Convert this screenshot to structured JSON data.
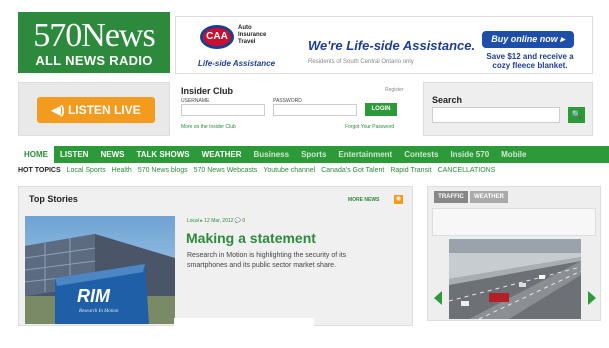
{
  "logo": {
    "line1": "570News",
    "line2": "ALL NEWS RADIO"
  },
  "ad": {
    "brand": "CAA",
    "brand_lines": [
      "Auto",
      "Insurance",
      "Travel"
    ],
    "tagline": "Life-side Assistance",
    "slogan": "We're Life-side Assistance.",
    "subtext": "Residents of South Central Ontario only",
    "button": "Buy online now ▸",
    "offer": "Save $12 and receive a cozy fleece blanket."
  },
  "listen": {
    "label": "LISTEN LIVE"
  },
  "insider": {
    "title": "Insider Club",
    "register": "Register",
    "username_label": "USERNAME",
    "password_label": "PASSWORD",
    "login": "LOGIN",
    "more": "More on the Insider Club",
    "forgot": "Forgot Your Password"
  },
  "search": {
    "title": "Search",
    "button": "🔍"
  },
  "nav": {
    "items": [
      {
        "label": "HOME"
      },
      {
        "label": "LISTEN"
      },
      {
        "label": "NEWS"
      },
      {
        "label": "TALK SHOWS"
      },
      {
        "label": "WEATHER"
      },
      {
        "label": "Business"
      },
      {
        "label": "Sports"
      },
      {
        "label": "Entertainment"
      },
      {
        "label": "Contests"
      },
      {
        "label": "Inside 570"
      },
      {
        "label": "Mobile"
      }
    ]
  },
  "hot_topics": {
    "label": "HOT TOPICS",
    "items": [
      "Local Sports",
      "Health",
      "570 News blogs",
      "570 News Webcasts",
      "Youtube channel",
      "Canada's Got Talent",
      "Rapid Transit",
      "CANCELLATIONS"
    ]
  },
  "top_stories": {
    "title": "Top Stories",
    "more": "MORE NEWS",
    "meta": "Local ▸ 12 Mar, 2012 💬 0",
    "headline": "Making a statement",
    "summary": "Research in Motion is highlighting the security of its smartphones and its public sector market share.",
    "photo_sign": "RIM",
    "photo_sign_sub": "Research In Motion"
  },
  "traffic": {
    "tab_traffic": "TRAFFIC",
    "tab_weather": "WEATHER"
  },
  "colors": {
    "green": "#2d9a3a",
    "orange": "#f39b1f",
    "caa_blue": "#1d3e8f"
  }
}
